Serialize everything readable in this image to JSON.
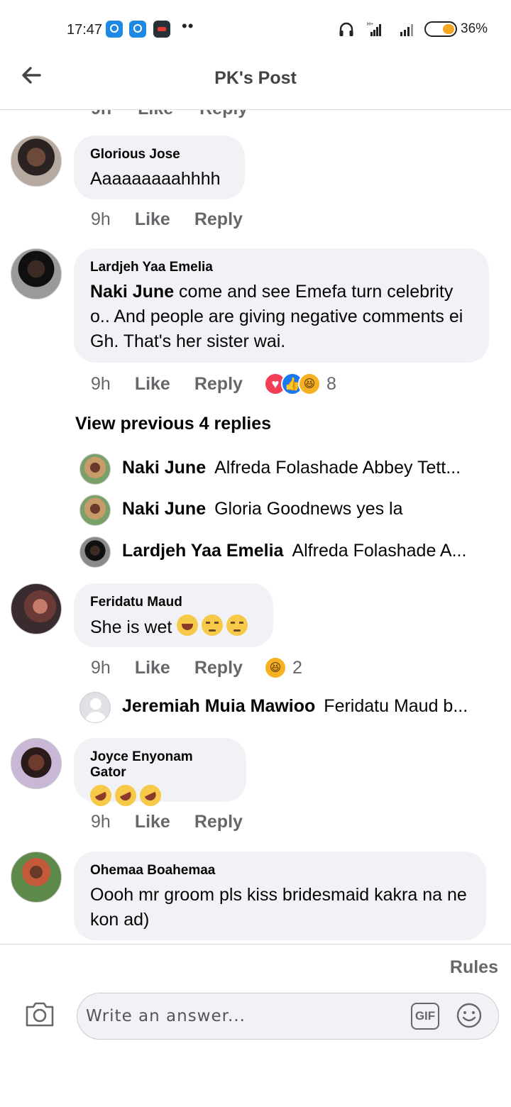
{
  "status_bar": {
    "time": "17:47",
    "battery": "36%",
    "icons": [
      "viber-icon",
      "viber-icon",
      "app-icon",
      "more-dots-icon",
      "headset-icon",
      "signal-icon",
      "signal-icon",
      "battery-icon"
    ]
  },
  "header": {
    "title": "PK's Post",
    "back_icon": "back-arrow-icon"
  },
  "peek": {
    "time": "9h",
    "like": "Like",
    "reply": "Reply"
  },
  "comments": [
    {
      "name": "Glorious Jose",
      "text": "Aaaaaaaaahhhh",
      "time": "9h",
      "like": "Like",
      "reply": "Reply"
    },
    {
      "name": "Lardjeh Yaa Emelia",
      "mention": "Naki June",
      "text": " come and see Emefa turn celebrity o.. And people are giving negative comments ei Gh. That's her sister wai.",
      "time": "9h",
      "like": "Like",
      "reply": "Reply",
      "reaction_count": "8",
      "reactions": [
        "love",
        "like",
        "haha"
      ]
    },
    {
      "name": "Feridatu Maud",
      "text": "She is wet",
      "emojis": [
        "face-with-tears-of-joy",
        "unamused-face",
        "unamused-face"
      ],
      "time": "9h",
      "like": "Like",
      "reply": "Reply",
      "reaction_count": "2",
      "reactions": [
        "haha"
      ]
    },
    {
      "name": "Joyce Enyonam Gator",
      "emojis": [
        "rolling-on-the-floor-laughing",
        "rolling-on-the-floor-laughing",
        "rolling-on-the-floor-laughing"
      ],
      "time": "9h",
      "like": "Like",
      "reply": "Reply"
    },
    {
      "name": "Ohemaa Boahemaa",
      "text": "Oooh mr groom pls kiss bridesmaid kakra na ne kon ad)"
    }
  ],
  "view_previous": "View previous 4 replies",
  "replies": [
    {
      "name": "Naki June",
      "text": "Alfreda Folashade Abbey Tett..."
    },
    {
      "name": "Naki June",
      "text": "Gloria Goodnews yes la"
    },
    {
      "name": "Lardjeh Yaa Emelia",
      "text": "Alfreda Folashade A..."
    }
  ],
  "reply_feridatu": {
    "name": "Jeremiah Muia Mawioo",
    "text": "Feridatu Maud b..."
  },
  "composer": {
    "rules": "Rules",
    "placeholder": "Write an answer...",
    "gif": "GIF"
  }
}
